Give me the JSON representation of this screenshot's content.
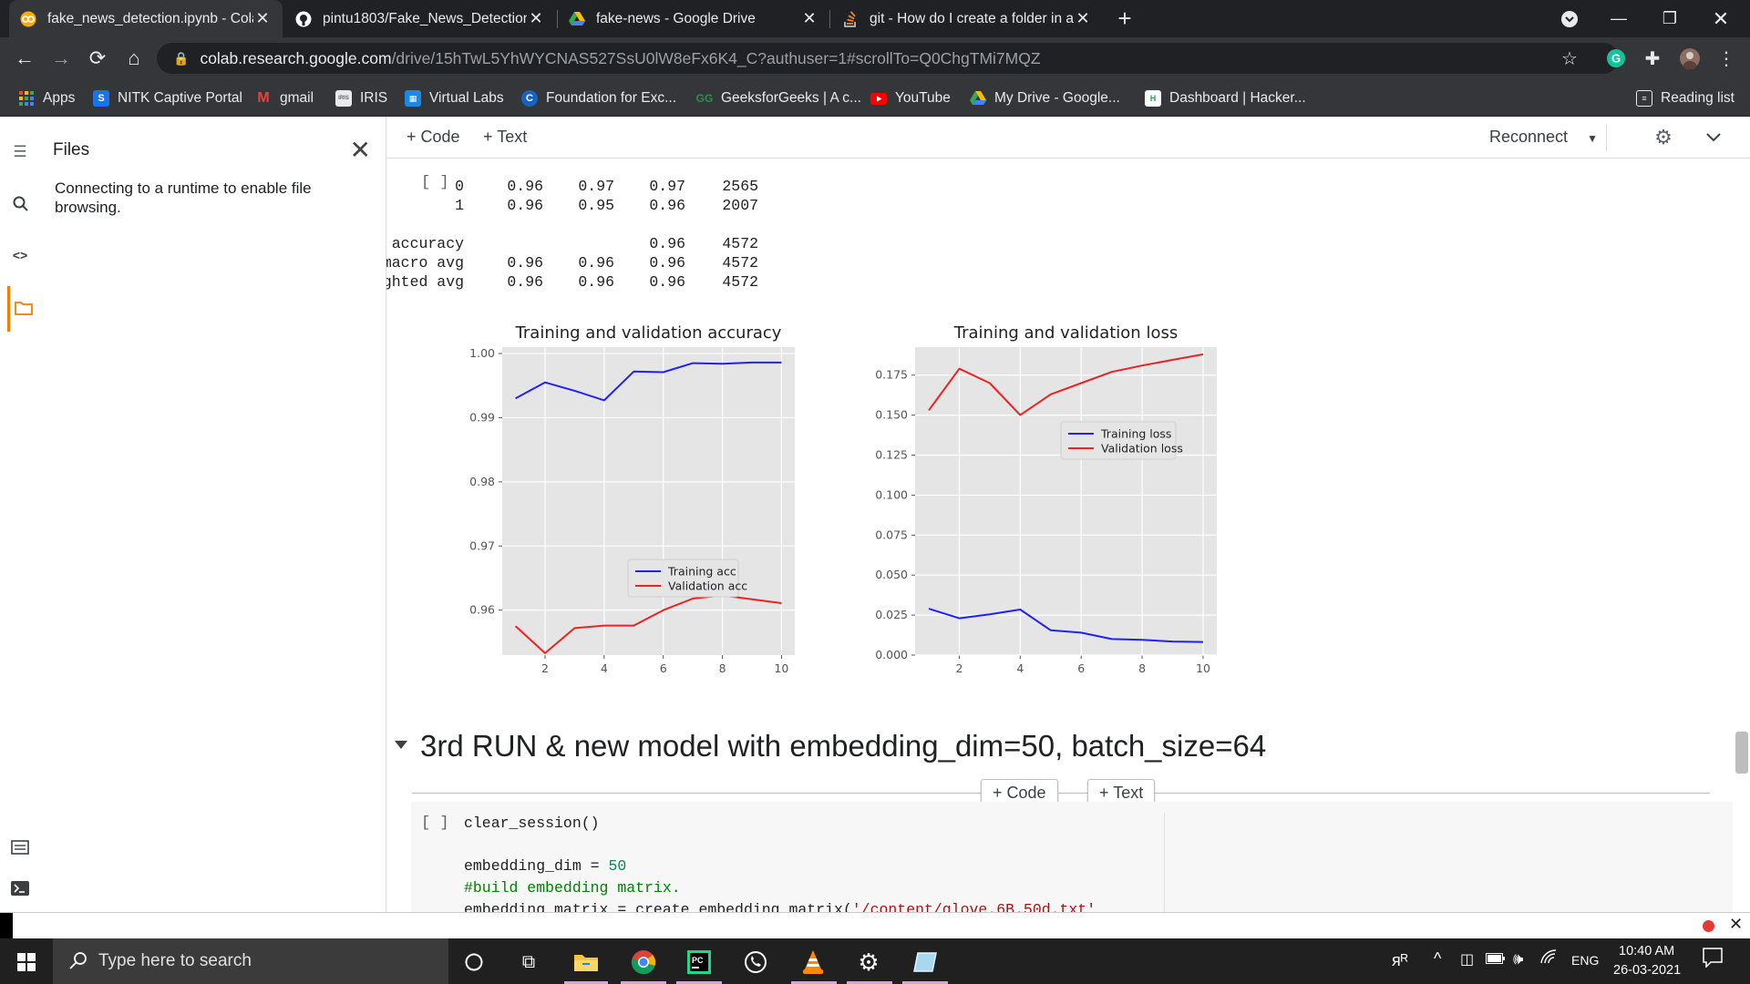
{
  "browser": {
    "tabs": [
      {
        "title": "fake_news_detection.ipynb - Cola",
        "icon": "colab-icon",
        "active": true
      },
      {
        "title": "pintu1803/Fake_News_Detection",
        "icon": "github-icon",
        "active": false
      },
      {
        "title": "fake-news - Google Drive",
        "icon": "drive-icon",
        "active": false
      },
      {
        "title": "git - How do I create a folder in a",
        "icon": "stackoverflow-icon",
        "active": false
      }
    ],
    "url_host": "colab.research.google.com",
    "url_path": "/drive/15hTwL5YhWYCNAS527SsU0lW8eFx6K4_C?authuser=1#scrollTo=Q0ChgTMi7MQZ",
    "bookmarks": [
      {
        "label": "Apps",
        "icon": "apps-icon"
      },
      {
        "label": "NITK Captive Portal",
        "icon": "s-icon"
      },
      {
        "label": "gmail",
        "icon": "gmail-icon"
      },
      {
        "label": "IRIS",
        "icon": "iris-icon"
      },
      {
        "label": "Virtual Labs",
        "icon": "virtual-labs-icon"
      },
      {
        "label": "Foundation for Exc...",
        "icon": "c-icon"
      },
      {
        "label": "GeeksforGeeks | A c...",
        "icon": "gfg-icon"
      },
      {
        "label": "YouTube",
        "icon": "youtube-icon"
      },
      {
        "label": "My Drive - Google...",
        "icon": "drive-icon"
      },
      {
        "label": "Dashboard | Hacker...",
        "icon": "hackerrank-icon"
      }
    ],
    "reading_list": "Reading list"
  },
  "sidebar": {
    "title": "Files",
    "message": "Connecting to a runtime to enable file browsing."
  },
  "toolbar": {
    "code_label": "+ Code",
    "text_label": "+ Text",
    "reconnect_label": "Reconnect"
  },
  "output": {
    "bracket": "[ ]",
    "report_rows": [
      {
        "label": "0",
        "precision": "0.96",
        "recall": "0.97",
        "f1": "0.97",
        "support": "2565"
      },
      {
        "label": "1",
        "precision": "0.96",
        "recall": "0.95",
        "f1": "0.96",
        "support": "2007"
      },
      {
        "label": "accuracy",
        "precision": "",
        "recall": "",
        "f1": "0.96",
        "support": "4572"
      },
      {
        "label": "macro avg",
        "precision": "0.96",
        "recall": "0.96",
        "f1": "0.96",
        "support": "4572"
      },
      {
        "label": "weighted avg",
        "precision": "0.96",
        "recall": "0.96",
        "f1": "0.96",
        "support": "4572"
      }
    ]
  },
  "chart_data": [
    {
      "type": "line",
      "title": "Training and validation accuracy",
      "x": [
        1,
        2,
        3,
        4,
        5,
        6,
        7,
        8,
        9,
        10
      ],
      "xticks": [
        2,
        4,
        6,
        8,
        10
      ],
      "yticks": [
        "1.00",
        "0.99",
        "0.98",
        "0.97",
        "0.96"
      ],
      "ylim": [
        0.953,
        1.001
      ],
      "xlim": [
        0.55,
        10.45
      ],
      "grid": true,
      "legend": "lower-right",
      "series": [
        {
          "name": "Training acc",
          "color": "#2222ee",
          "values": [
            0.993,
            0.9955,
            0.9942,
            0.9927,
            0.9972,
            0.9971,
            0.9985,
            0.9984,
            0.9986,
            0.9986
          ]
        },
        {
          "name": "Validation acc",
          "color": "#ee2222",
          "values": [
            0.9575,
            0.9533,
            0.9572,
            0.9576,
            0.9576,
            0.96,
            0.9618,
            0.9623,
            0.9617,
            0.9611
          ]
        }
      ]
    },
    {
      "type": "line",
      "title": "Training and validation loss",
      "x": [
        1,
        2,
        3,
        4,
        5,
        6,
        7,
        8,
        9,
        10
      ],
      "xticks": [
        2,
        4,
        6,
        8,
        10
      ],
      "yticks": [
        "0.175",
        "0.150",
        "0.125",
        "0.100",
        "0.075",
        "0.050",
        "0.025",
        "0.000"
      ],
      "ylim": [
        0.0,
        0.1925
      ],
      "xlim": [
        0.55,
        10.45
      ],
      "grid": true,
      "legend": "center-right",
      "series": [
        {
          "name": "Training loss",
          "color": "#2222ee",
          "values": [
            0.029,
            0.023,
            0.0255,
            0.0285,
            0.0155,
            0.014,
            0.01,
            0.0095,
            0.0085,
            0.0082
          ]
        },
        {
          "name": "Validation loss",
          "color": "#ee2222",
          "values": [
            0.153,
            0.179,
            0.17,
            0.15,
            0.163,
            0.17,
            0.177,
            0.181,
            0.1845,
            0.188
          ]
        }
      ]
    }
  ],
  "section": {
    "heading": "3rd RUN & new model with embedding_dim=50, batch_size=64"
  },
  "code_cell": {
    "bracket": "[ ]",
    "line1": "clear_session()",
    "line2a": "embedding_dim = ",
    "line2b": "50",
    "line3": "#build embedding matrix.",
    "line4a": "embedding_matrix = create_embedding_matrix(",
    "line4b": "'/content/glove.6B.50d.txt'"
  },
  "taskbar": {
    "search_placeholder": "Type here to search",
    "lang": "ENG",
    "time": "10:40 AM",
    "date": "26-03-2021"
  }
}
